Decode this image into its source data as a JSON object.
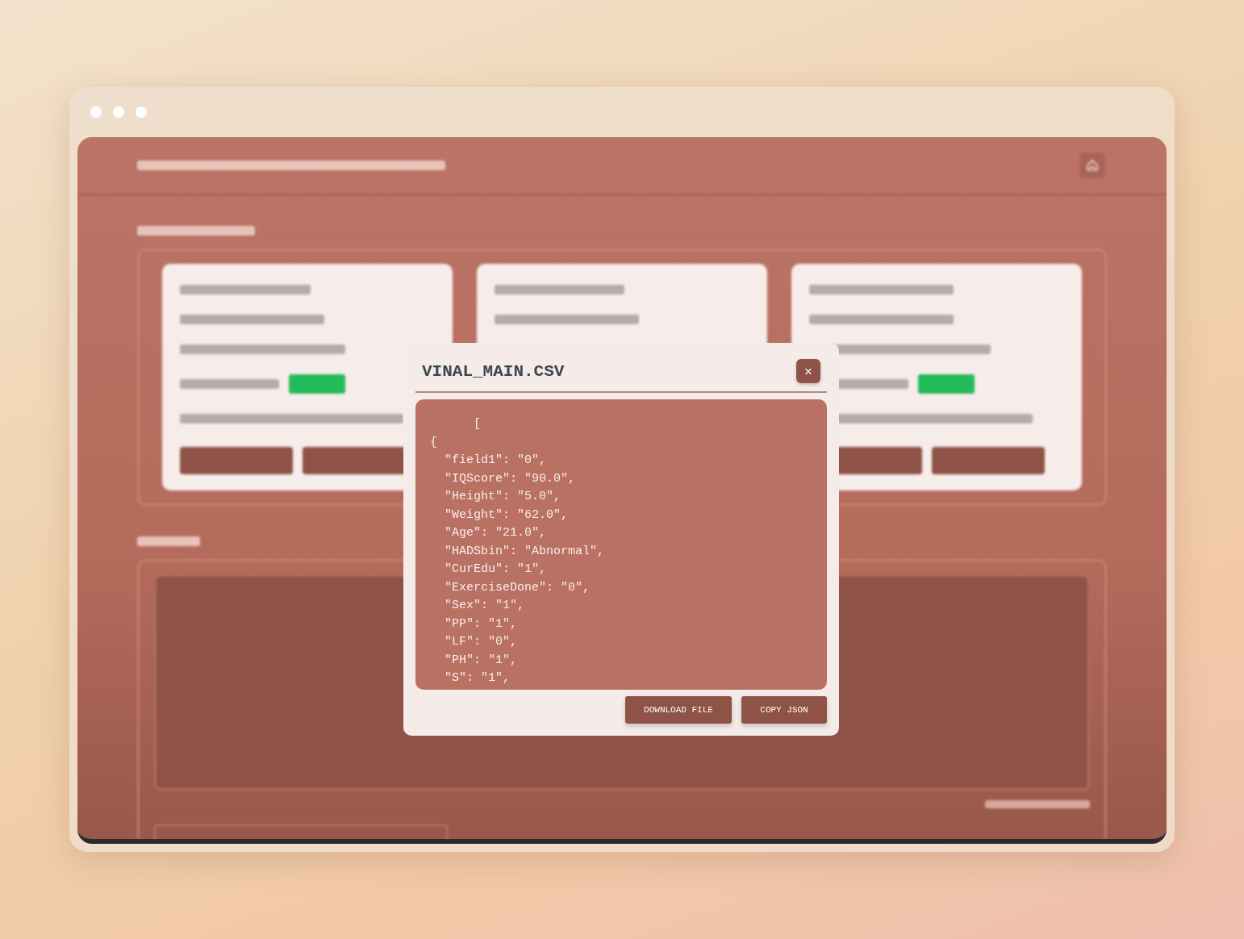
{
  "modal": {
    "title": "VINAL_MAIN.CSV",
    "close": "×",
    "content": "      [\n{\n  \"field1\": \"0\",\n  \"IQScore\": \"90.0\",\n  \"Height\": \"5.0\",\n  \"Weight\": \"62.0\",\n  \"Age\": \"21.0\",\n  \"HADSbin\": \"Abnormal\",\n  \"CurEdu\": \"1\",\n  \"ExerciseDone\": \"0\",\n  \"Sex\": \"1\",\n  \"PP\": \"1\",\n  \"LF\": \"0\",\n  \"PH\": \"1\",\n  \"S\": \"1\",",
    "buttons": [
      "DOWNLOAD FILE",
      "COPY JSON"
    ]
  }
}
